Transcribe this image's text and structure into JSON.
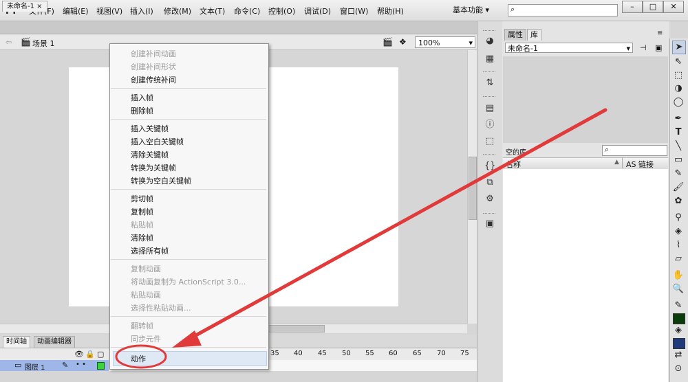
{
  "app": {
    "logo": "Fl"
  },
  "menubar": {
    "items": [
      "文件(F)",
      "编辑(E)",
      "视图(V)",
      "插入(I)",
      "修改(M)",
      "文本(T)",
      "命令(C)",
      "控制(O)",
      "调试(D)",
      "窗口(W)",
      "帮助(H)"
    ],
    "workspace": "基本功能",
    "window_buttons": [
      "–",
      "□",
      "✕"
    ]
  },
  "document": {
    "tab": "未命名-1",
    "tab_close": "×",
    "scene": "场景 1",
    "zoom": "100%"
  },
  "timeline": {
    "tabs": [
      "时间轴",
      "动画编辑器"
    ],
    "frame_numbers": [
      "35",
      "40",
      "45",
      "50",
      "55",
      "60",
      "65",
      "70",
      "75"
    ],
    "layer": "图层 1",
    "layer_marks": "• •"
  },
  "library": {
    "tabs": [
      "属性",
      "库"
    ],
    "document": "未命名-1",
    "empty_label": "空的库",
    "col_name": "名称",
    "col_link": "AS 链接"
  },
  "context_menu": {
    "items": [
      {
        "label": "创建补间动画",
        "enabled": false
      },
      {
        "label": "创建补间形状",
        "enabled": false
      },
      {
        "label": "创建传统补间",
        "enabled": true
      },
      {
        "label": "插入帧",
        "enabled": true
      },
      {
        "label": "删除帧",
        "enabled": true
      },
      {
        "label": "插入关键帧",
        "enabled": true
      },
      {
        "label": "插入空白关键帧",
        "enabled": true
      },
      {
        "label": "清除关键帧",
        "enabled": true
      },
      {
        "label": "转换为关键帧",
        "enabled": true
      },
      {
        "label": "转换为空白关键帧",
        "enabled": true
      },
      {
        "label": "剪切帧",
        "enabled": true
      },
      {
        "label": "复制帧",
        "enabled": true
      },
      {
        "label": "粘贴帧",
        "enabled": false
      },
      {
        "label": "清除帧",
        "enabled": true
      },
      {
        "label": "选择所有帧",
        "enabled": true
      },
      {
        "label": "复制动画",
        "enabled": false
      },
      {
        "label": "将动画复制为 ActionScript 3.0...",
        "enabled": false
      },
      {
        "label": "粘贴动画",
        "enabled": false
      },
      {
        "label": "选择性粘贴动画...",
        "enabled": false
      },
      {
        "label": "翻转帧",
        "enabled": false
      },
      {
        "label": "同步元件",
        "enabled": false
      },
      {
        "label": "动作",
        "enabled": true
      }
    ]
  },
  "colors": {
    "annotation": "#e03a3a",
    "stroke": "#0a3d0a",
    "fill": "#1f3a7a",
    "layer_highlight": "#9fb6e8"
  }
}
